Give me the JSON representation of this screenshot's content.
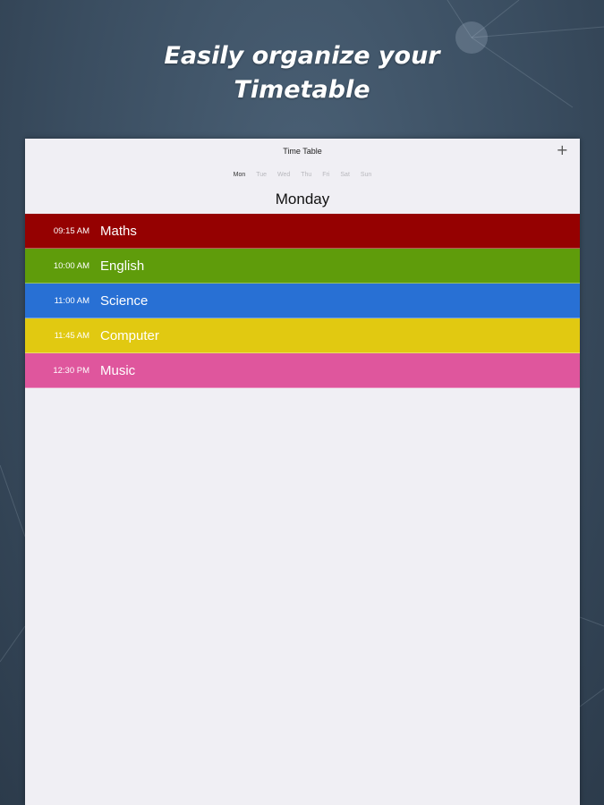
{
  "headline": {
    "line1": "Easily organize your",
    "line2": "Timetable"
  },
  "app": {
    "nav_title": "Time Table",
    "add_label": "+",
    "days": [
      "Mon",
      "Tue",
      "Wed",
      "Thu",
      "Fri",
      "Sat",
      "Sun"
    ],
    "selected_day_index": 0,
    "day_heading": "Monday"
  },
  "classes": [
    {
      "time": "09:15 AM",
      "subject": "Maths",
      "color": "#950101"
    },
    {
      "time": "10:00 AM",
      "subject": "English",
      "color": "#5f9c0b"
    },
    {
      "time": "11:00 AM",
      "subject": "Science",
      "color": "#2870d4"
    },
    {
      "time": "11:45 AM",
      "subject": "Computer",
      "color": "#e1c911"
    },
    {
      "time": "12:30 PM",
      "subject": "Music",
      "color": "#df569d"
    }
  ]
}
